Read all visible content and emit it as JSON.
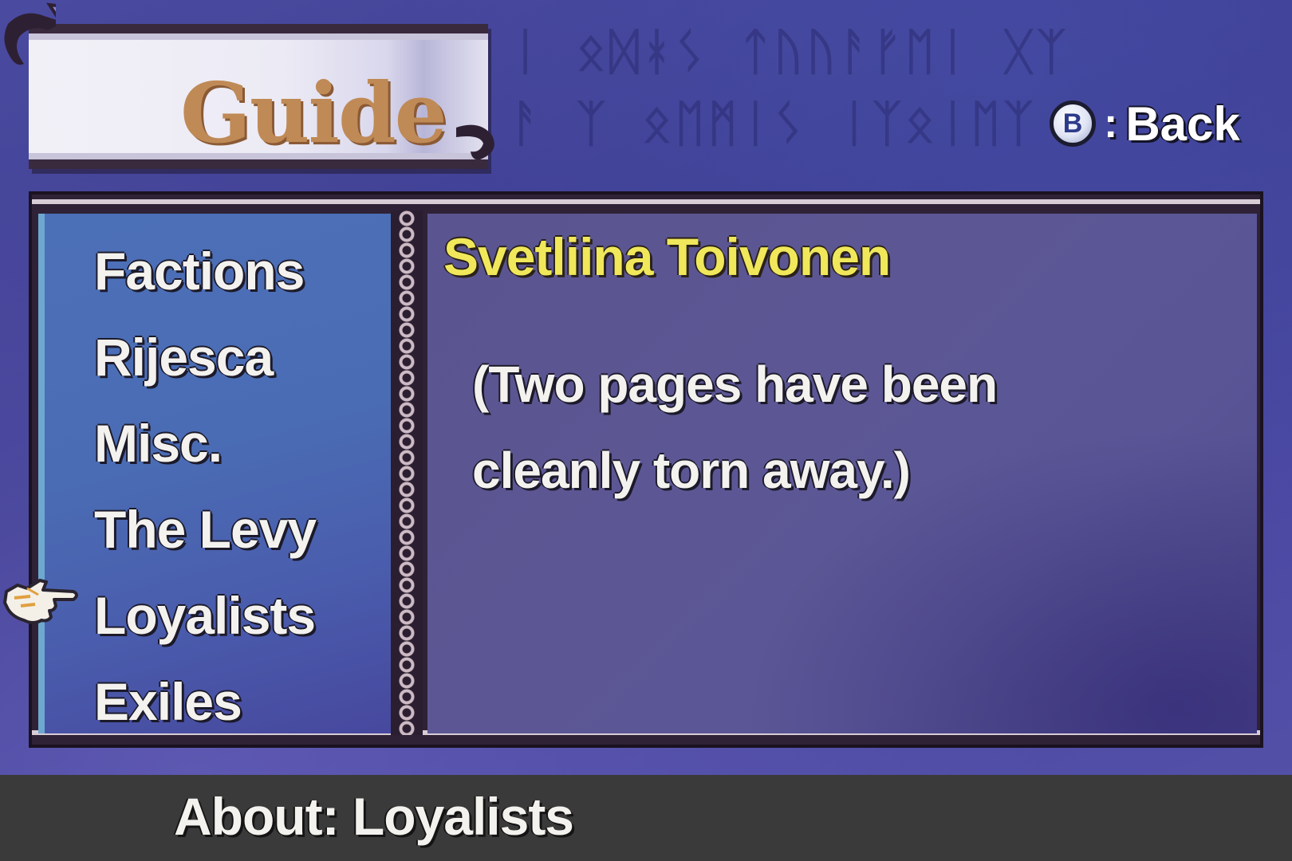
{
  "header": {
    "title": "Guide",
    "back_button": {
      "button_glyph": "B",
      "separator": ":",
      "label": "Back"
    }
  },
  "menu": {
    "selected_index": 4,
    "items": [
      {
        "label": "Factions"
      },
      {
        "label": "Rijesca"
      },
      {
        "label": "Misc."
      },
      {
        "label": "The Levy"
      },
      {
        "label": "Loyalists"
      },
      {
        "label": "Exiles"
      }
    ]
  },
  "entry": {
    "title": "Svetliina Toivonen",
    "body_line_1": "(Two pages have been",
    "body_line_2": "cleanly torn away.)"
  },
  "help_bar": {
    "text": "About: Loyalists"
  },
  "colors": {
    "background": "#3e3e92",
    "menu_panel": "#4a6cb4",
    "content_panel": "#5a5490",
    "entry_title": "#f0e85a",
    "title_text": "#c08a56",
    "help_bar": "#3a3a3a"
  },
  "icons": {
    "pointer": "pointing-hand-icon",
    "back": "b-button-icon"
  }
}
